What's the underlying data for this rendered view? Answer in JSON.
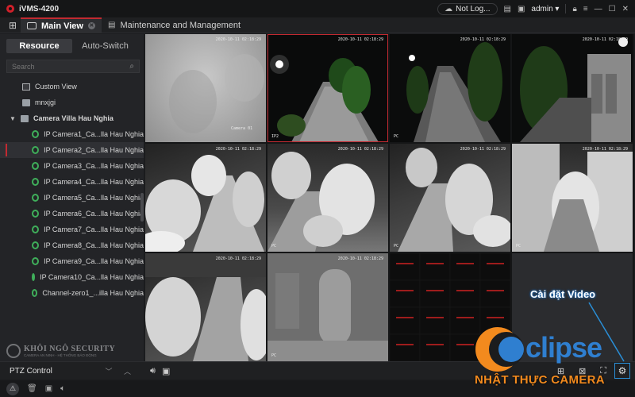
{
  "app": {
    "title": "iVMS-4200"
  },
  "titlebar": {
    "cloud_label": "Not Log...",
    "user": "admin"
  },
  "tabs": [
    {
      "label": "Main View",
      "active": true
    },
    {
      "label": "Maintenance and Management",
      "active": false
    }
  ],
  "sidebar": {
    "segments": [
      "Resource",
      "Auto-Switch"
    ],
    "search_placeholder": "Search",
    "tree": {
      "custom_view": "Custom View",
      "group1": "mnxjgi",
      "group2": "Camera Villa Hau Nghia",
      "cameras": [
        "IP Camera1_Ca...lla Hau Nghia",
        "IP Camera2_Ca...lla Hau Nghia",
        "IP Camera3_Ca...lla Hau Nghia",
        "IP Camera4_Ca...lla Hau Nghia",
        "IP Camera5_Ca...lla Hau Nghia",
        "IP Camera6_Ca...lla Hau Nghia",
        "IP Camera7_Ca...lla Hau Nghia",
        "IP Camera8_Ca...lla Hau Nghia",
        "IP Camera9_Ca...lla Hau Nghia",
        "IP Camera10_Ca...lla Hau Nghia",
        "Channel-zero1_...illa Hau Nghia"
      ]
    },
    "watermark": {
      "title": "KHÔI NGÔ SECURITY",
      "subtitle": "CAMERA AN NINH - HỆ THỐNG BÁO ĐỘNG"
    }
  },
  "video": {
    "tiles": [
      {
        "time": "2020-10-11 02:18:29",
        "name": "Camera 01"
      },
      {
        "time": "2020-10-11 02:18:29",
        "name": "IP2"
      },
      {
        "time": "2020-10-11 02:18:29",
        "name": "PC"
      },
      {
        "time": "2020-10-11 02:18:29",
        "name": ""
      },
      {
        "time": "2020-10-11 02:18:29",
        "name": ""
      },
      {
        "time": "2020-10-11 02:18:29",
        "name": "PC"
      },
      {
        "time": "2020-10-11 02:18:29",
        "name": "PC"
      },
      {
        "time": "2020-10-11 02:18:29",
        "name": "PC"
      },
      {
        "time": "2020-10-11 02:18:29",
        "name": ""
      },
      {
        "time": "2020-10-11 02:18:29",
        "name": "PC"
      },
      {
        "time": "",
        "name": ""
      },
      {
        "time": "",
        "name": ""
      }
    ]
  },
  "bottombar": {
    "ptz_label": "PTZ Control"
  },
  "overlay": {
    "annotation": "Cài đặt Video",
    "brand_word": "clipse",
    "brand_tagline": "NHẬT THỰC CAMERA"
  },
  "colors": {
    "accent_red": "#c22a31",
    "camera_online": "#3fae5a",
    "highlight_blue": "#2a8ed6",
    "brand_orange": "#f28a1e",
    "brand_blue": "#2f7fd0"
  }
}
